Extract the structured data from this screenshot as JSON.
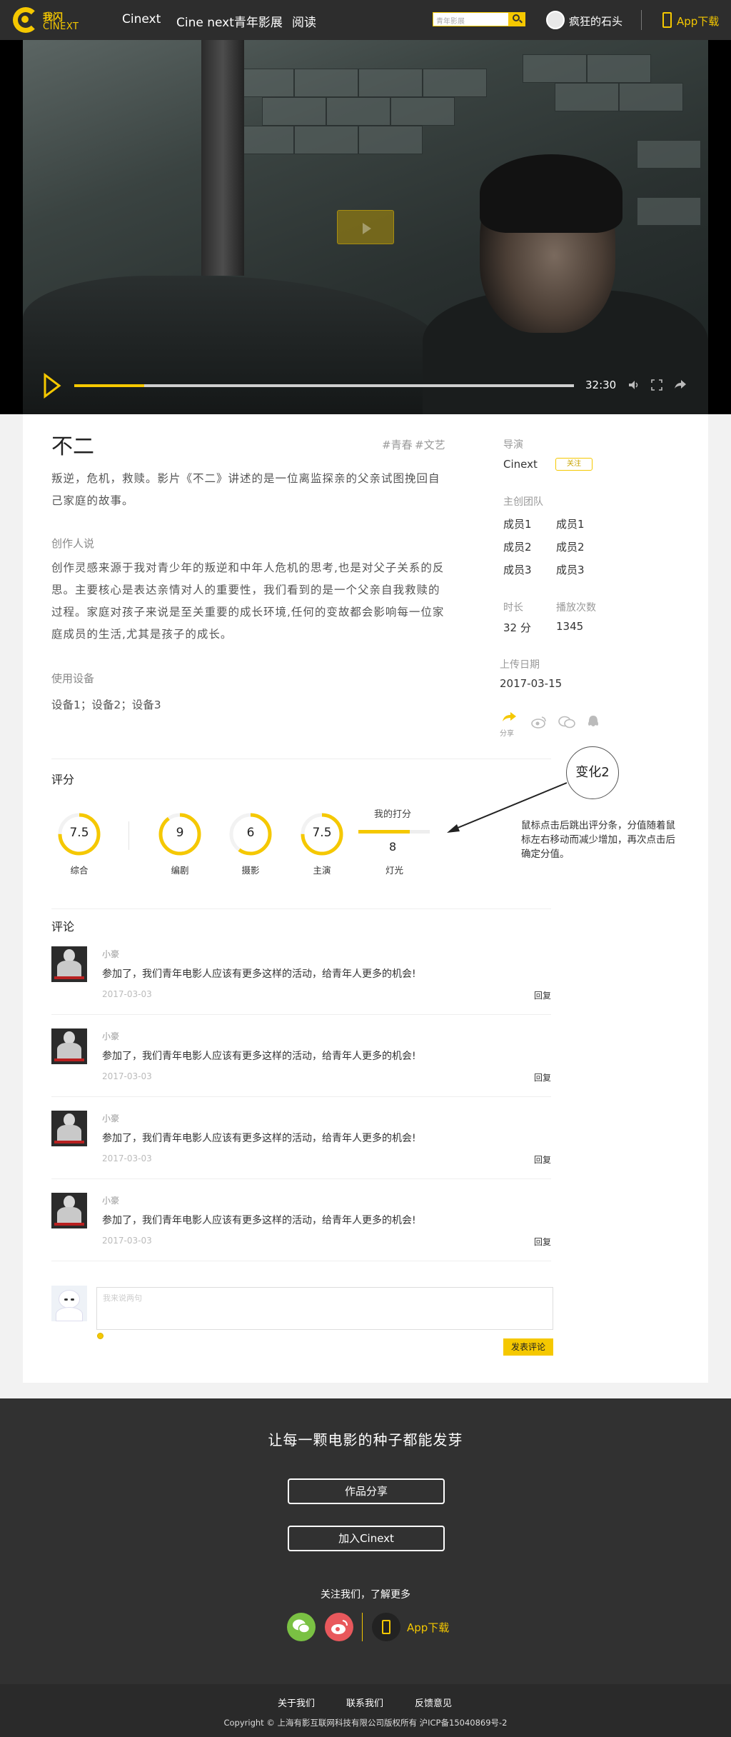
{
  "header": {
    "logo_line1": "我闪",
    "logo_line2": "CINEXT",
    "nav": [
      "Cinext",
      "Cine next青年影展",
      "阅读"
    ],
    "search_placeholder": "青年影展",
    "user_name": "疯狂的石头",
    "app_download": "App下载"
  },
  "video": {
    "duration": "32:30",
    "progress": 0.14
  },
  "film": {
    "title": "不二",
    "tags": [
      "#青春",
      "#文艺"
    ],
    "synopsis": "叛逆，危机，救赎。影片《不二》讲述的是一位离监探亲的父亲试图挽回自己家庭的故事。",
    "creator_heading": "创作人说",
    "creator_text": "创作灵感来源于我对青少年的叛逆和中年人危机的思考,也是对父子关系的反思。主要核心是表达亲情对人的重要性，我们看到的是一个父亲自我救赎的过程。家庭对孩子来说是至关重要的成长环境,任何的变故都会影响每一位家庭成员的生活,尤其是孩子的成长。",
    "equipment_heading": "使用设备",
    "equipment_text": "设备1；设备2；设备3"
  },
  "sidebar": {
    "director_label": "导演",
    "director_name": "Cinext",
    "follow_label": "关注",
    "team_label": "主创团队",
    "team": [
      [
        "成员1",
        "成员1"
      ],
      [
        "成员2",
        "成员2"
      ],
      [
        "成员3",
        "成员3"
      ]
    ],
    "duration_label": "时长",
    "duration_value": "32 分",
    "plays_label": "播放次数",
    "plays_value": "1345",
    "upload_label": "上传日期",
    "upload_value": "2017-03-15",
    "share_label": "分享"
  },
  "rating": {
    "heading": "评分",
    "items": [
      {
        "label": "综合",
        "value": "7.5",
        "fraction": 0.75
      },
      {
        "label": "编剧",
        "value": "9",
        "fraction": 0.9
      },
      {
        "label": "摄影",
        "value": "6",
        "fraction": 0.6
      },
      {
        "label": "主演",
        "value": "7.5",
        "fraction": 0.75
      }
    ],
    "my_score_label": "我的打分",
    "my_score_value": "8",
    "my_score_fraction": 0.8,
    "my_score_category": "灯光",
    "annotation_bubble": "变化2",
    "annotation_text": "鼠标点击后跳出评分条，分值随着鼠标左右移动而减少增加，再次点击后确定分值。"
  },
  "comments": {
    "heading": "评论",
    "items": [
      {
        "user": "小豪",
        "text": "参加了，我们青年电影人应该有更多这样的活动，给青年人更多的机会!",
        "date": "2017-03-03",
        "reply": "回复"
      },
      {
        "user": "小豪",
        "text": "参加了，我们青年电影人应该有更多这样的活动，给青年人更多的机会!",
        "date": "2017-03-03",
        "reply": "回复"
      },
      {
        "user": "小豪",
        "text": "参加了，我们青年电影人应该有更多这样的活动，给青年人更多的机会!",
        "date": "2017-03-03",
        "reply": "回复"
      },
      {
        "user": "小豪",
        "text": "参加了，我们青年电影人应该有更多这样的活动，给青年人更多的机会!",
        "date": "2017-03-03",
        "reply": "回复"
      }
    ],
    "input_placeholder": "我来说两句",
    "submit_label": "发表评论"
  },
  "footer": {
    "slogan": "让每一颗电影的种子都能发芽",
    "share_works": "作品分享",
    "join": "加入Cinext",
    "follow_more": "关注我们，了解更多",
    "app_download": "App下载",
    "links": [
      "关于我们",
      "联系我们",
      "反馈意见"
    ],
    "copyright": "Copyright © 上海有影互联网科技有限公司版权所有 沪ICP备15040869号-2"
  },
  "colors": {
    "accent": "#f5c800",
    "header_bg": "#2d2d2d",
    "footer_bg": "#313131"
  }
}
